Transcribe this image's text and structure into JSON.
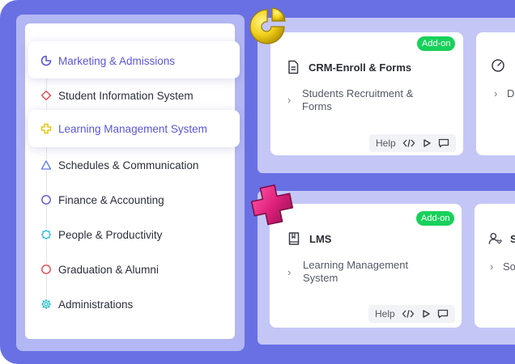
{
  "sidebar": {
    "items": [
      {
        "label": "Marketing & Admissions",
        "icon": "pie-chart-icon",
        "active": true
      },
      {
        "label": "Student Information System",
        "icon": "diamond-icon"
      },
      {
        "label": "Learning Management System",
        "icon": "cross-icon",
        "active": true
      },
      {
        "label": "Schedules & Communication",
        "icon": "triangle-icon"
      },
      {
        "label": "Finance & Accounting",
        "icon": "circle-icon"
      },
      {
        "label": "People & Productivity",
        "icon": "badge-icon"
      },
      {
        "label": "Graduation & Alumni",
        "icon": "circle-icon"
      },
      {
        "label": "Administrations",
        "icon": "gear-icon"
      }
    ]
  },
  "cards": {
    "crm": {
      "badge": "Add-on",
      "title": "CRM-Enroll & Forms",
      "desc": "Students Recruitment & Forms",
      "help": "Help"
    },
    "crm_partial": {
      "desc": "D"
    },
    "lms": {
      "badge": "Add-on",
      "title": "LMS",
      "desc": "Learning Management System",
      "help": "Help"
    },
    "lms_partial": {
      "title": "S",
      "desc": "So"
    }
  },
  "colors": {
    "background": "#6970e3",
    "active": "#5b55d8",
    "badge": "#18d15a",
    "deco_yellow": "#f2d21c",
    "deco_pink": "#e0227c"
  }
}
